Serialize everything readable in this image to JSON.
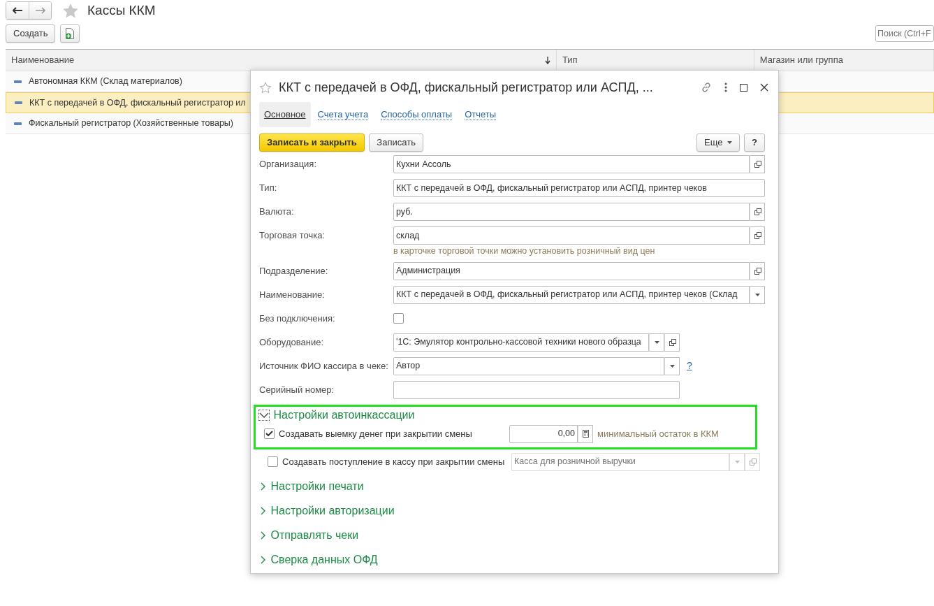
{
  "page": {
    "title": "Кассы ККМ",
    "create_button": "Создать",
    "search": {
      "placeholder": "Поиск (Ctrl+F"
    }
  },
  "table": {
    "columns": [
      {
        "label": "Наименование",
        "sorted": true
      },
      {
        "label": "Тип",
        "sorted": false
      },
      {
        "label": "Магазин или группа",
        "sorted": false
      }
    ],
    "rows": [
      {
        "name": "Автономная ККМ (Склад материалов)",
        "selected": false
      },
      {
        "name": "ККТ с передачей в ОФД, фискальный регистратор ил",
        "selected": true
      },
      {
        "name": "Фискальный регистратор (Хозяйственные товары)",
        "selected": false
      }
    ]
  },
  "dialog": {
    "title": "ККТ с передачей в ОФД, фискальный регистратор или АСПД, ...",
    "tabs": [
      {
        "label": "Основное",
        "selected": true
      },
      {
        "label": "Счета учета",
        "selected": false
      },
      {
        "label": "Способы оплаты",
        "selected": false
      },
      {
        "label": "Отчеты",
        "selected": false
      }
    ],
    "buttons": {
      "save_close": "Записать и закрыть",
      "save": "Записать",
      "more": "Еще",
      "help": "?"
    },
    "fields": [
      {
        "kind": "input",
        "label": "Организация:",
        "value": "Кухни Ассоль",
        "open_button": true,
        "dropdown": false,
        "wide": true
      },
      {
        "kind": "input",
        "label": "Тип:",
        "value": "ККТ с передачей в ОФД, фискальный регистратор или АСПД, принтер чеков",
        "open_button": false,
        "dropdown": false,
        "wide": true
      },
      {
        "kind": "input",
        "label": "Валюта:",
        "value": "руб.",
        "open_button": true,
        "dropdown": false,
        "wide": true
      },
      {
        "kind": "input",
        "label": "Торговая точка:",
        "value": "склад",
        "open_button": true,
        "dropdown": false,
        "wide": true
      },
      {
        "kind": "hint",
        "text": "в карточке торговой точки можно установить розничный вид цен"
      },
      {
        "kind": "input",
        "label": "Подразделение:",
        "value": "Администрация",
        "open_button": true,
        "dropdown": false,
        "wide": true
      },
      {
        "kind": "input",
        "label": "Наименование:",
        "value": "ККТ с передачей в ОФД, фискальный регистратор или АСПД, принтер чеков (Склад",
        "open_button": false,
        "dropdown": true,
        "wide": true
      },
      {
        "kind": "checkbox",
        "label": "Без подключения:",
        "checked": false
      },
      {
        "kind": "input",
        "label": "Оборудование:",
        "value": "'1С: Эмулятор контрольно-кассовой техники нового образца",
        "open_button": true,
        "dropdown": true,
        "wide": false
      },
      {
        "kind": "input",
        "label": "Источник ФИО кассира в чеке:",
        "value": "Автор",
        "open_button": false,
        "dropdown": true,
        "wide": false,
        "help": "?"
      },
      {
        "kind": "input",
        "label": "Серийный номер:",
        "open_button": false,
        "dropdown": false,
        "wide": false
      }
    ],
    "sections": [
      {
        "title": "Настройки автоинкассации",
        "expanded": true,
        "highlighted": true,
        "items": [
          {
            "label": "Создавать выемку денег при закрытии смены",
            "checked": true,
            "highlighted": true,
            "kind": "number",
            "value": "0,00",
            "note": "минимальный остаток в ККМ"
          },
          {
            "label": "Создавать поступление в кассу при закрытии смены",
            "checked": false,
            "highlighted": false,
            "kind": "select",
            "placeholder": "Касса для розничной выручки",
            "disabled": true
          }
        ]
      },
      {
        "title": "Настройки печати",
        "expanded": false,
        "highlighted": false
      },
      {
        "title": "Настройки авторизации",
        "expanded": false,
        "highlighted": false
      },
      {
        "title": "Отправлять чеки",
        "expanded": false,
        "highlighted": false
      },
      {
        "title": "Сверка данных ОФД",
        "expanded": false,
        "highlighted": false
      }
    ]
  }
}
